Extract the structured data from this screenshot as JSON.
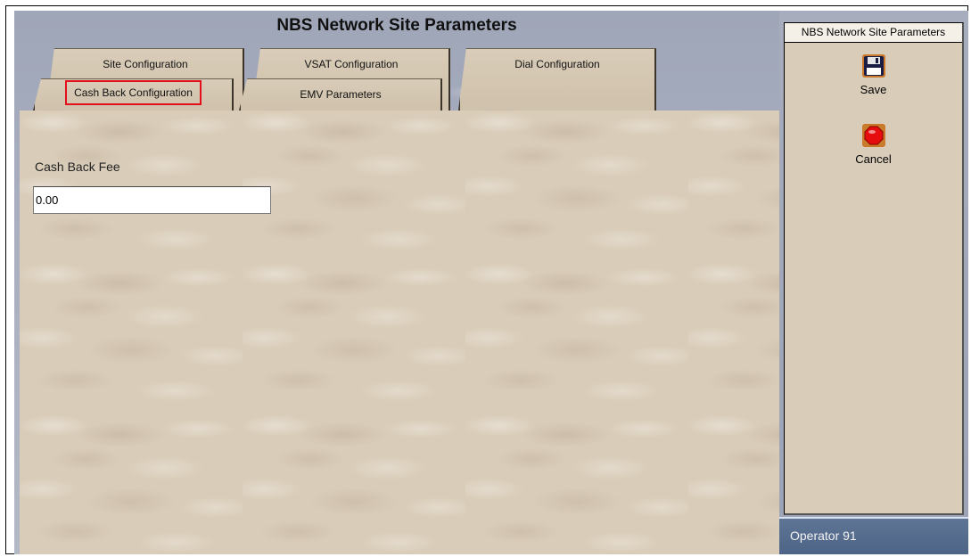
{
  "window": {
    "title": "NBS Network Site Parameters"
  },
  "tabs": {
    "back_row": [
      {
        "label": "Site Configuration"
      },
      {
        "label": "VSAT Configuration"
      },
      {
        "label": "Dial Configuration"
      }
    ],
    "front_row": [
      {
        "label": "Cash Back Configuration",
        "selected": true
      },
      {
        "label": "EMV Parameters"
      }
    ]
  },
  "form": {
    "cash_back_fee_label": "Cash Back Fee",
    "cash_back_fee_value": "0.00"
  },
  "sidepanel": {
    "title": "NBS Network Site Parameters",
    "save": {
      "label": "Save",
      "icon": "floppy-disk-icon"
    },
    "cancel": {
      "label": "Cancel",
      "icon": "stop-sign-icon"
    }
  },
  "status": {
    "operator": "Operator 91"
  },
  "colors": {
    "selected_tab_highlight": "#e3101b",
    "panel_background": "#d9ccb8",
    "status_bar": "#5f7596"
  }
}
